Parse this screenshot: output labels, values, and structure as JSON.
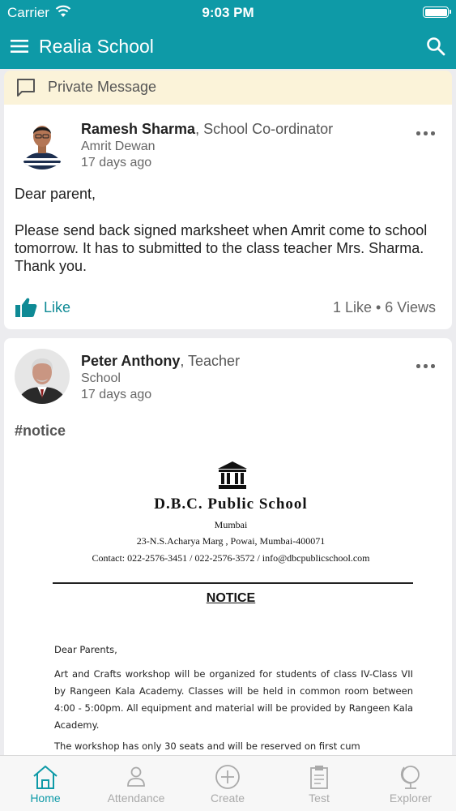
{
  "status_bar": {
    "carrier": "Carrier",
    "time": "9:03 PM"
  },
  "app_bar": {
    "title": "Realia School"
  },
  "private_message": {
    "label": "Private Message"
  },
  "posts": [
    {
      "author": "Ramesh Sharma",
      "role": ", School Co-ordinator",
      "context": "Amrit Dewan",
      "time": "17 days ago",
      "greeting": "Dear parent,",
      "body": "Please send back signed marksheet when Amrit come to school tomorrow. It has to submitted to the class teacher Mrs. Sharma. Thank you.",
      "like_label": "Like",
      "stats": "1 Like • 6 Views"
    },
    {
      "author": "Peter Anthony",
      "role": ", Teacher",
      "context": "School",
      "time": "17 days ago",
      "hashtag": "#notice",
      "attachment": {
        "school_name": "D.B.C. Public School",
        "city": "Mumbai",
        "address": "23-N.S.Acharya Marg , Powai, Mumbai-400071",
        "contact": "Contact: 022-2576-3451 / 022-2576-3572 / info@dbcpublicschool.com",
        "heading": "NOTICE",
        "salutation": "Dear Parents,",
        "paragraph1": "Art and Crafts workshop will be organized for students of class IV-Class VII by Rangeen Kala Academy. Classes will be held in common room between 4:00 - 5:00pm. All equipment and material will be provided by Rangeen Kala Academy.",
        "paragraph2": "The workshop has only 30 seats and will be reserved on first cum"
      }
    }
  ],
  "tab_bar": {
    "tabs": [
      {
        "label": "Home",
        "icon": "home-icon",
        "active": true
      },
      {
        "label": "Attendance",
        "icon": "person-icon",
        "active": false
      },
      {
        "label": "Create",
        "icon": "plus-circle-icon",
        "active": false
      },
      {
        "label": "Test",
        "icon": "clipboard-icon",
        "active": false
      },
      {
        "label": "Explorer",
        "icon": "globe-icon",
        "active": false
      }
    ]
  },
  "colors": {
    "brand": "#0e9aa7",
    "banner": "#fbf3d9",
    "inactive_tab": "#aaaaaa"
  }
}
